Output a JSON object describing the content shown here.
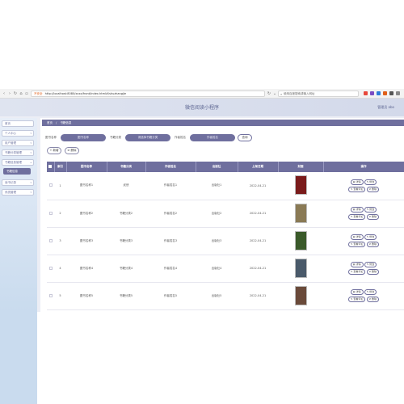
{
  "browser": {
    "url_warning": "不安全",
    "url": "http://localhost:8080/xxxx/front/index.html#/shuzhangjie",
    "search_placeholder": "使用百度搜索或输入网址"
  },
  "app": {
    "title": "微信阅读小程序",
    "user": "管理员 abo"
  },
  "sidebar": {
    "items": [
      {
        "label": "首页"
      },
      {
        "label": "个人中心"
      },
      {
        "label": "用户管理"
      },
      {
        "label": "书籍分类管理"
      },
      {
        "label": "书籍信息管理"
      },
      {
        "label": "书籍信息",
        "active": true
      },
      {
        "label": "读书记录"
      },
      {
        "label": "系统管理"
      }
    ]
  },
  "breadcrumb": {
    "home": "首页",
    "sep": "/",
    "current": "书籍信息"
  },
  "filters": {
    "name_label": "图书名称",
    "name_placeholder": "图书名称",
    "category_label": "书籍分类",
    "category_placeholder": "请选择书籍分类",
    "author_label": "作者姓名",
    "author_placeholder": "作者姓名",
    "query_button": "查询"
  },
  "actions": {
    "add": "+ 新增",
    "delete": "删除"
  },
  "table": {
    "headers": [
      "",
      "索引",
      "图书名称",
      "书籍分类",
      "作者姓名",
      "出版社",
      "上架日期",
      "封面",
      "操作"
    ],
    "rows": [
      {
        "index": "1",
        "name": "图书名称1",
        "category": "武侠",
        "author": "作者姓名1",
        "publisher": "出版社1",
        "date": "2022-04-21",
        "cover_color": "#7a1b1b"
      },
      {
        "index": "2",
        "name": "图书名称2",
        "category": "书籍分类2",
        "author": "作者姓名2",
        "publisher": "出版社2",
        "date": "2022-04-21",
        "cover_color": "#8a7a55"
      },
      {
        "index": "3",
        "name": "图书名称3",
        "category": "书籍分类3",
        "author": "作者姓名3",
        "publisher": "出版社3",
        "date": "2022-04-21",
        "cover_color": "#3a5a2a"
      },
      {
        "index": "4",
        "name": "图书名称4",
        "category": "书籍分类4",
        "author": "作者姓名4",
        "publisher": "出版社4",
        "date": "2022-04-21",
        "cover_color": "#4a5a6a"
      },
      {
        "index": "5",
        "name": "图书名称5",
        "category": "书籍分类5",
        "author": "作者姓名5",
        "publisher": "出版社5",
        "date": "2022-04-21",
        "cover_color": "#6a4a3a"
      }
    ],
    "ops": {
      "detail": "详情",
      "edit": "修改",
      "comment": "查看评论",
      "remove": "删除"
    }
  }
}
